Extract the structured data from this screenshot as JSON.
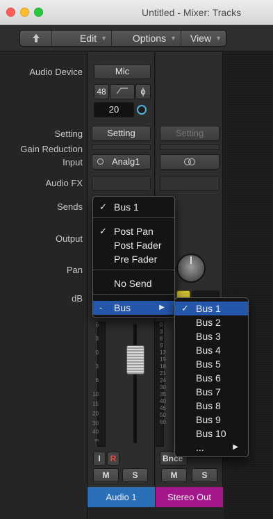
{
  "window": {
    "title": "Untitled - Mixer: Tracks"
  },
  "toolbar": {
    "back_icon": "up-arrow-icon",
    "edit": "Edit",
    "options": "Options",
    "view": "View"
  },
  "labels": {
    "audio_device": "Audio Device",
    "setting": "Setting",
    "gain_reduction": "Gain Reduction",
    "input": "Input",
    "audio_fx": "Audio FX",
    "sends": "Sends",
    "output": "Output",
    "pan": "Pan",
    "db": "dB"
  },
  "device": {
    "name": "Mic",
    "buffer": "48",
    "phase_symbol": "ϕ",
    "gain": "20"
  },
  "strip1": {
    "setting": "Setting",
    "input": "Analg1",
    "input_icon": "mono-circle-icon",
    "name": "Audio 1",
    "record_enable": "I",
    "record": "R",
    "mute": "M",
    "solo": "S",
    "color": "#2a6fb8"
  },
  "strip2": {
    "setting": "Setting",
    "input_icon": "stereo-link-icon",
    "bounce": "Bnce",
    "mute": "M",
    "solo": "S",
    "name": "Stereo Out",
    "color": "#a4168c"
  },
  "meter_scale": [
    "0",
    "3",
    "6",
    "9",
    "12",
    "15",
    "18",
    "21",
    "24",
    "30",
    "35",
    "40",
    "45",
    "50",
    "60"
  ],
  "fader_scale": [
    "6",
    "3",
    "0",
    "3",
    "6",
    "10",
    "15",
    "20",
    "30",
    "40",
    "∞"
  ],
  "sends_menu": {
    "items": [
      {
        "label": "Bus 1",
        "checked": true
      },
      {
        "label": "Post Pan",
        "checked": true
      },
      {
        "label": "Post Fader",
        "checked": false
      },
      {
        "label": "Pre Fader",
        "checked": false
      },
      {
        "label": "No Send",
        "checked": false
      },
      {
        "label": "Bus",
        "prefix": "-",
        "submenu": true
      }
    ]
  },
  "bus_menu": {
    "items": [
      "Bus 1",
      "Bus 2",
      "Bus 3",
      "Bus 4",
      "Bus 5",
      "Bus 6",
      "Bus 7",
      "Bus 8",
      "Bus 9",
      "Bus 10",
      "..."
    ],
    "checked": "Bus 1"
  }
}
